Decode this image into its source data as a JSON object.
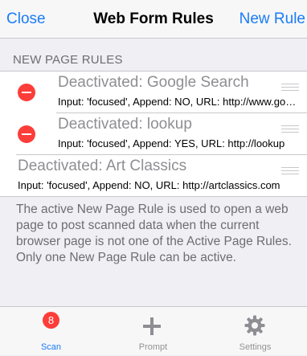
{
  "navbar": {
    "close_label": "Close",
    "title": "Web Form Rules",
    "new_rule_label": "New Rule"
  },
  "section": {
    "header": "NEW PAGE RULES",
    "rows": [
      {
        "title": "Deactivated: Google Search",
        "subtitle": "Input: 'focused', Append: NO, URL: http://www.google.com",
        "delete_visible": true
      },
      {
        "title": "Deactivated: lookup",
        "subtitle": "Input: 'focused', Append: YES, URL: http://lookup",
        "delete_visible": true
      },
      {
        "title": "Deactivated: Art Classics",
        "subtitle": "Input: 'focused', Append: NO, URL: http://artclassics.com",
        "delete_visible": false
      }
    ],
    "footer": "The active New Page Rule is used to open a web page to post scanned data when the current browser page is not one of the Active Page Rules. Only one New Page Rule can be active."
  },
  "tabbar": {
    "tabs": [
      {
        "label": "Scan",
        "icon": "scan-icon",
        "badge": "8",
        "selected": true
      },
      {
        "label": "Prompt",
        "icon": "plus-icon",
        "selected": false
      },
      {
        "label": "Settings",
        "icon": "gear-icon",
        "selected": false
      }
    ]
  },
  "colors": {
    "accent": "#1a7cf5",
    "delete_red": "#fc3d39",
    "background": "#efeff4"
  }
}
